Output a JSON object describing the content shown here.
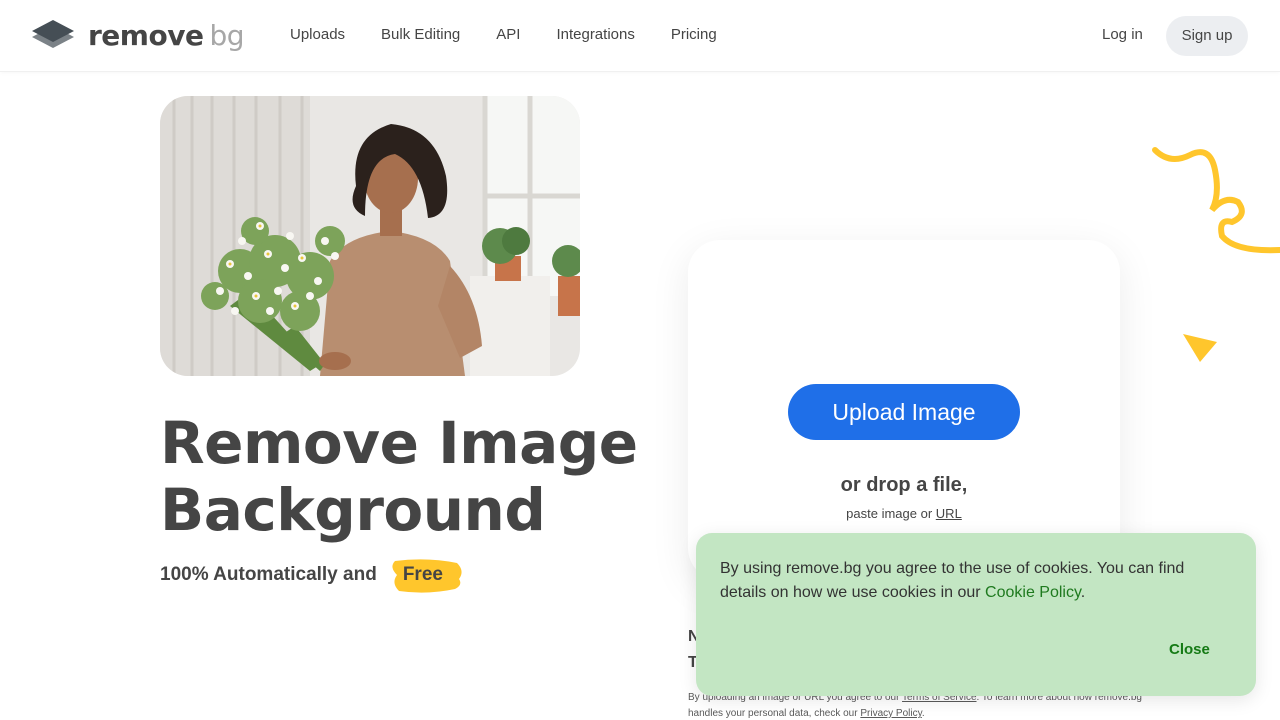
{
  "brand": {
    "name": "remove",
    "suffix": "bg"
  },
  "nav": {
    "items": [
      {
        "label": "Uploads"
      },
      {
        "label": "Bulk Editing"
      },
      {
        "label": "API"
      },
      {
        "label": "Integrations"
      },
      {
        "label": "Pricing"
      }
    ]
  },
  "auth": {
    "login": "Log in",
    "signup": "Sign up"
  },
  "hero": {
    "title_line1": "Remove Image",
    "title_line2": "Background",
    "subtitle": "100% Automatically and",
    "free": "Free"
  },
  "upload": {
    "button": "Upload Image",
    "drop": "or drop a file,",
    "paste_prefix": "paste image or",
    "paste_link": "URL"
  },
  "hidden": {
    "line1": "N",
    "line2": "T"
  },
  "legal": {
    "prefix": "By uploading an image or URL you agree to our",
    "tos": "Terms of Service",
    "middle": ". To learn more about how remove.bg handles your personal data, check our",
    "privacy": "Privacy Policy",
    "end": "."
  },
  "cookie": {
    "text": "By using remove.bg you agree to the use of cookies. You can find details on how we use cookies in our",
    "link": "Cookie Policy",
    "end": ".",
    "close": "Close"
  },
  "colors": {
    "accent": "#1f6fe8",
    "cookie_bg": "#c3e6c3",
    "highlight": "#ffc62c",
    "text": "#454545"
  }
}
